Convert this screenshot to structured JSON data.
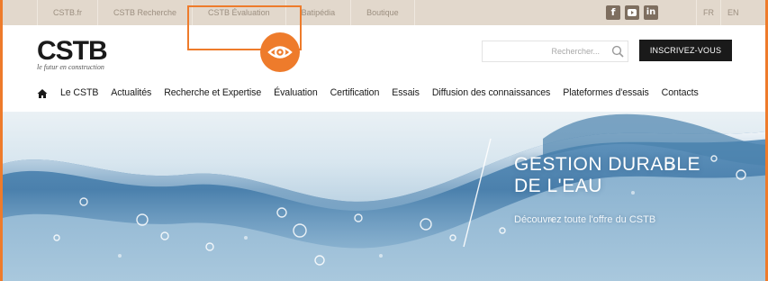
{
  "topbar": {
    "links": [
      "CSTB.fr",
      "CSTB Recherche",
      "CSTB Évaluation",
      "Batipédia",
      "Boutique"
    ],
    "social": [
      {
        "icon": "facebook-icon",
        "glyph": "f"
      },
      {
        "icon": "youtube-icon",
        "glyph": "▶"
      },
      {
        "icon": "linkedin-icon",
        "glyph": "in"
      }
    ],
    "languages": [
      "FR",
      "EN"
    ]
  },
  "logo": {
    "text": "CSTB",
    "tagline": "le futur en construction"
  },
  "search": {
    "placeholder": "Rechercher..."
  },
  "cta": {
    "label": "INSCRIVEZ-VOUS"
  },
  "nav": {
    "items": [
      "Le CSTB",
      "Actualités",
      "Recherche et Expertise",
      "Évaluation",
      "Certification",
      "Essais",
      "Diffusion des connaissances",
      "Plateformes d'essais",
      "Contacts"
    ]
  },
  "hero": {
    "title_line1": "GESTION DURABLE",
    "title_line2": "DE L'EAU",
    "subtitle": "Découvrez toute l'offre du CSTB"
  },
  "colors": {
    "accent": "#ee7b2b",
    "topbar_bg": "#e2d8cc",
    "dark": "#1a1a1a",
    "water": "#9bbdd5"
  }
}
